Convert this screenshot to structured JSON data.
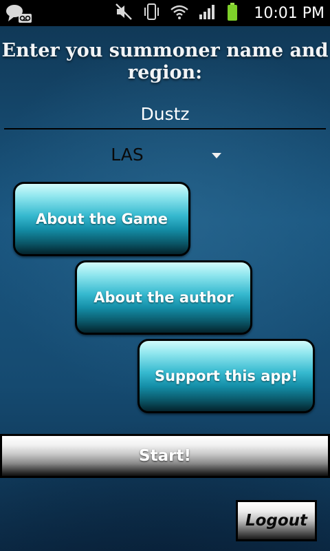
{
  "status_bar": {
    "time": "10:01 PM",
    "icons": [
      "chat-voicemail-icon",
      "mute-icon",
      "vibrate-icon",
      "wifi-icon",
      "signal-icon",
      "battery-icon"
    ],
    "battery_color": "#7ed12a"
  },
  "prompt": "Enter you summoner name and region:",
  "summoner_name": {
    "value": "Dustz"
  },
  "region": {
    "selected": "LAS"
  },
  "buttons": {
    "about_game": "About the Game",
    "about_author": "About the author",
    "support": "Support this app!",
    "start": "Start!",
    "logout": "Logout"
  },
  "colors": {
    "teal_button_top": "#d2fbfb",
    "teal_button_mid": "#148da6",
    "background": "#16466b"
  }
}
